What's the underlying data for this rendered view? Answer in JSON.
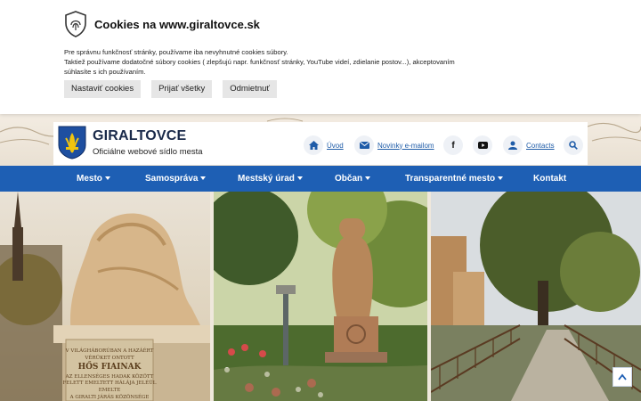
{
  "cookie": {
    "title": "Cookies na www.giraltovce.sk",
    "text_line1": "Pre správnu funkčnosť stránky, používame iba nevyhnutné cookies súbory.",
    "text_line2": "Taktiež používame dodatočné súbory cookies ( zlepšujú napr. funkčnosť stránky, YouTube videí, zdielanie postov...), akceptovaním",
    "text_line3": "súhlasíte s ich používaním.",
    "buttons": [
      "Nastaviť cookies",
      "Prijať všetky",
      "Odmietnuť"
    ]
  },
  "header": {
    "site_name": "GIRALTOVCE",
    "subtitle": "Oficiálne webové sídlo mesta",
    "links": {
      "home": "Úvod",
      "newsletter": "Novinky e-mailom",
      "contacts": "Contacts"
    }
  },
  "nav": {
    "items": [
      "Mesto",
      "Samospráva",
      "Mestský úrad",
      "Občan",
      "Transparentné mesto",
      "Kontakt"
    ]
  },
  "photos": {
    "plaque_lines": [
      "V VILÁGHÁBORÚBAN A HAZÁÉRT",
      "VÉRÜKET ONTOTT",
      "HŐS FIAINAK",
      "AZ ELLENSÉGES HADAK KÖZÖTT",
      "FELETT EMELTETT HÁLÁJA JELÉÜL",
      "EMELTE",
      "A GIRALTI JÁRÁS KÖZÖNSÉGE"
    ]
  },
  "colors": {
    "nav": "#1e5fb4",
    "link": "#1f5ca8",
    "title": "#1a2a4a"
  }
}
